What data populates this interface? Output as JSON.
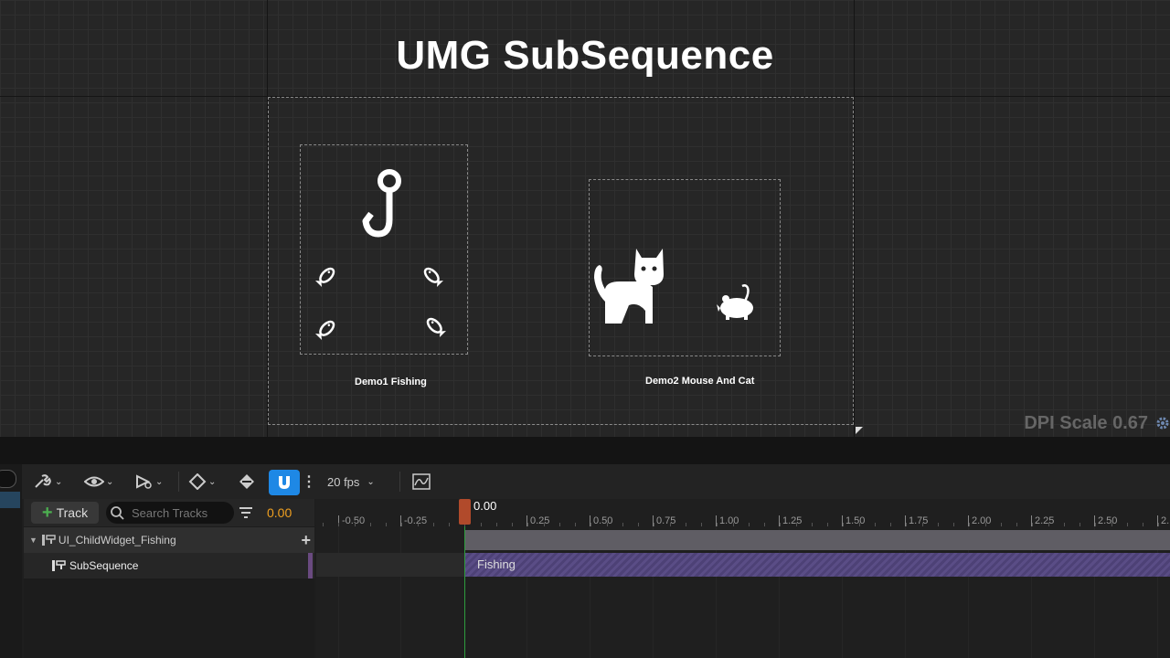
{
  "designer": {
    "title": "UMG SubSequence",
    "demo1_label": "Demo1 Fishing",
    "demo2_label": "Demo2 Mouse And Cat",
    "dpi_scale": "DPI Scale 0.67"
  },
  "toolbar": {
    "fps": "20 fps"
  },
  "outliner": {
    "track_button": "Track",
    "search_placeholder": "Search Tracks",
    "current_time": "0.00",
    "rows": [
      {
        "label": "UI_ChildWidget_Fishing"
      },
      {
        "label": "SubSequence"
      }
    ]
  },
  "timeline": {
    "playhead_time": "0.00",
    "ticks": [
      "-0.50",
      "-0.25",
      "0.25",
      "0.50",
      "0.75",
      "1.00",
      "1.25",
      "1.50",
      "1.75",
      "2.00",
      "2.25",
      "2.50",
      "2."
    ],
    "section_label": "Fishing"
  },
  "colors": {
    "accent": "#1e88e5",
    "playhead": "#b14a2b",
    "current_time": "#f0a020",
    "section": "#5a4d86"
  }
}
